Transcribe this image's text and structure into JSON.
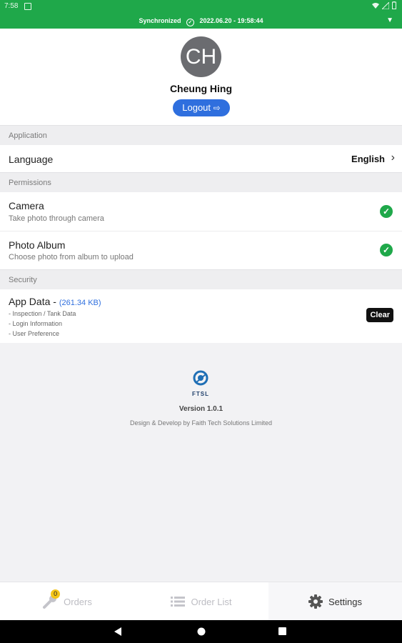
{
  "status_bar": {
    "time": "7:58"
  },
  "sync_bar": {
    "label": "Synchronized",
    "timestamp": "2022.06.20 - 19:58:44"
  },
  "profile": {
    "initials": "CH",
    "name": "Cheung Hing",
    "logout_label": "Logout"
  },
  "sections": {
    "application": {
      "header": "Application",
      "language_label": "Language",
      "language_value": "English"
    },
    "permissions": {
      "header": "Permissions",
      "camera_title": "Camera",
      "camera_sub": "Take photo through camera",
      "album_title": "Photo Album",
      "album_sub": "Choose photo from album to upload"
    },
    "security": {
      "header": "Security",
      "app_data_title": "App Data - ",
      "app_data_size": "(261.34 KB)",
      "items": [
        "- Inspection / Tank Data",
        "- Login Information",
        "- User Preference"
      ],
      "clear_label": "Clear"
    }
  },
  "footer": {
    "brand": "FTSL",
    "version": "Version 1.0.1",
    "credit": "Design & Develop by Faith Tech Solutions Limited"
  },
  "tabs": {
    "orders": "Orders",
    "orders_badge": "0",
    "order_list": "Order List",
    "settings": "Settings"
  },
  "colors": {
    "green": "#1fa84a",
    "blue": "#2f6fde",
    "dark": "#111111"
  }
}
